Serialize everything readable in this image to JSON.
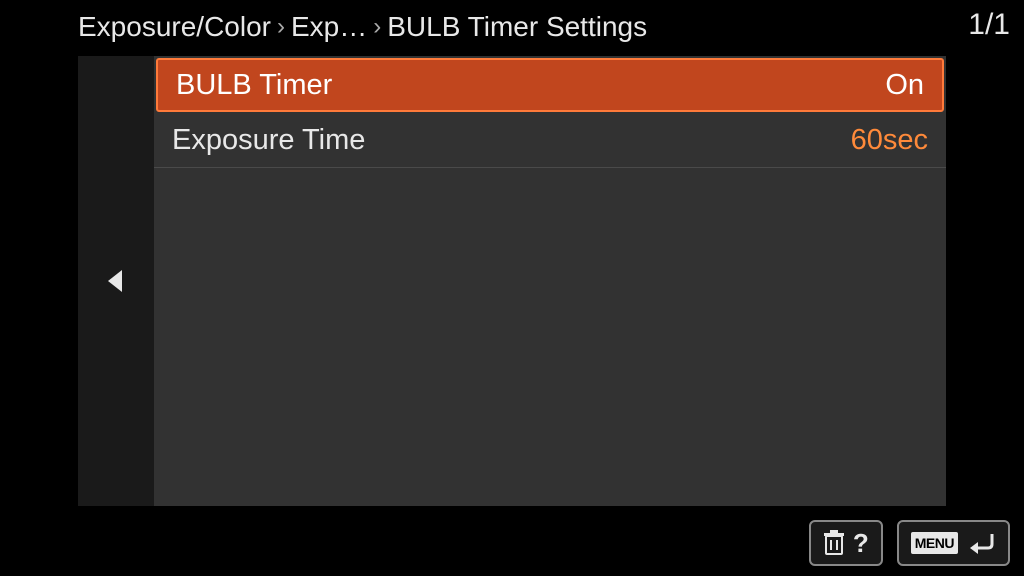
{
  "breadcrumb": {
    "level1": "Exposure/Color",
    "level2": "Exp…",
    "level3": "BULB Timer Settings"
  },
  "page_counter": "1/1",
  "menu": {
    "items": [
      {
        "label": "BULB Timer",
        "value": "On",
        "selected": true
      },
      {
        "label": "Exposure Time",
        "value": "60sec",
        "selected": false
      }
    ]
  },
  "footer": {
    "help_symbol": "?",
    "menu_label": "MENU"
  },
  "colors": {
    "accent": "#c1461e",
    "accent_value": "#ff8a3a",
    "panel_bg": "#323232"
  }
}
